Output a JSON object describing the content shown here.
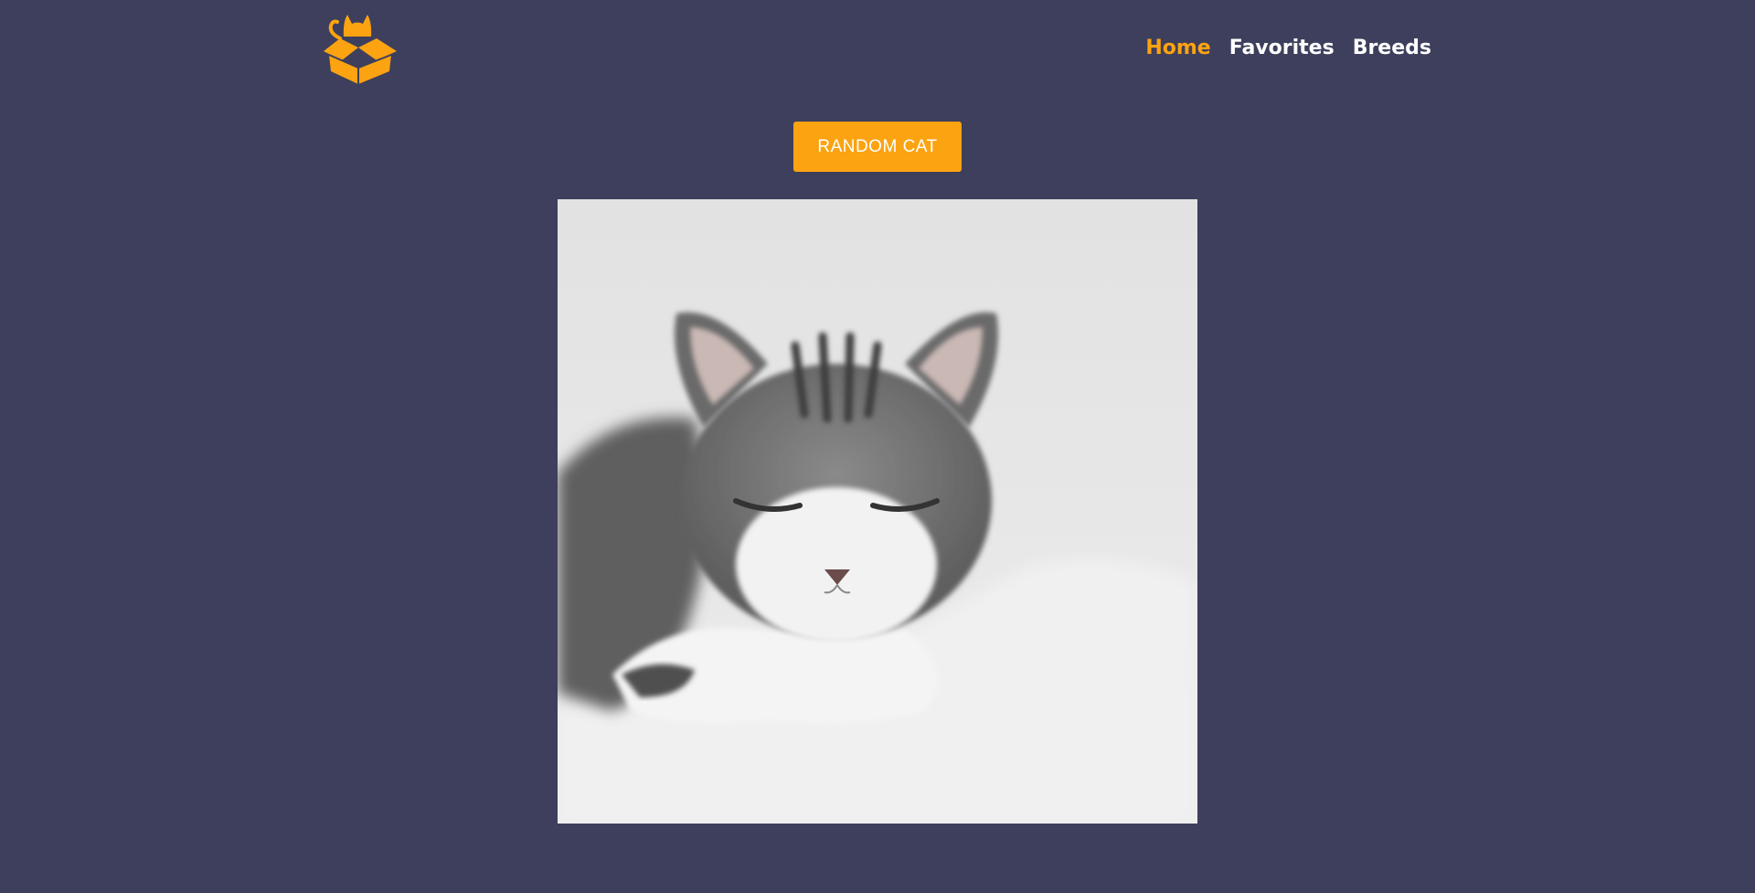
{
  "header": {
    "logo_icon": "cat-in-box-icon",
    "nav": [
      {
        "label": "Home",
        "active": true
      },
      {
        "label": "Favorites",
        "active": false
      },
      {
        "label": "Breeds",
        "active": false
      }
    ]
  },
  "main": {
    "button_label": "RANDOM CAT",
    "image_subject": "sleeping-tabby-cat-photo"
  },
  "colors": {
    "background": "#3d3f5c",
    "accent": "#fca311",
    "text": "#ffffff"
  }
}
